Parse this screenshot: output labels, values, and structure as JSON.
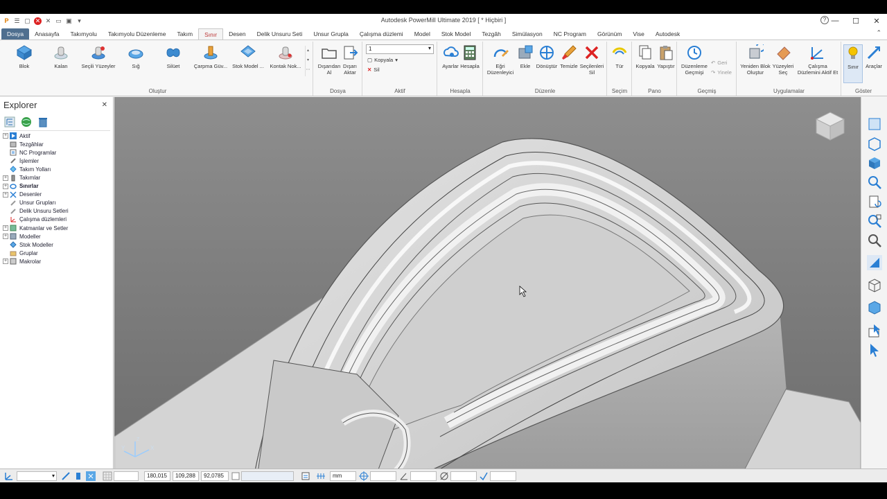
{
  "app": {
    "title": "Autodesk PowerMill Ultimate 2019   [ * Hiçbiri ]"
  },
  "window_controls": {
    "minimize": "—",
    "maximize": "☐",
    "close": "✕",
    "help": "?"
  },
  "tabs": [
    {
      "label": "Dosya"
    },
    {
      "label": "Anasayfa"
    },
    {
      "label": "Takımyolu"
    },
    {
      "label": "Takımyolu Düzenleme"
    },
    {
      "label": "Takım"
    },
    {
      "label": "Sınır"
    },
    {
      "label": "Desen"
    },
    {
      "label": "Delik Unsuru Seti"
    },
    {
      "label": "Unsur Grupla"
    },
    {
      "label": "Çalışma düzlemi"
    },
    {
      "label": "Model"
    },
    {
      "label": "Stok Model"
    },
    {
      "label": "Tezgâh"
    },
    {
      "label": "Simülasyon"
    },
    {
      "label": "NC Program"
    },
    {
      "label": "Görünüm"
    },
    {
      "label": "Vise"
    },
    {
      "label": "Autodesk"
    }
  ],
  "ribbon": {
    "olustur": {
      "label": "Oluştur",
      "buttons": [
        "Blok",
        "Kalan",
        "Seçili Yüzeyler",
        "Sığ",
        "Silüet",
        "Çarpma Güv...",
        "Stok Model ...",
        "Kontak Nok..."
      ]
    },
    "dosya": {
      "label": "Dosya",
      "buttons": [
        "Dışarıdan Al",
        "Dışarı Aktar"
      ]
    },
    "aktif": {
      "label": "Aktif",
      "combo_value": "1",
      "kopyala": "Kopyala",
      "sil": "Sil"
    },
    "hesapla": {
      "label": "Hesapla",
      "buttons": [
        "Ayarlar",
        "Hesapla"
      ]
    },
    "duzenle": {
      "label": "Düzenle",
      "buttons": [
        "Eğri Düzenleyici",
        "Ekle",
        "Dönüştür",
        "Temizle",
        "Seçilenleri Sil"
      ]
    },
    "secim": {
      "label": "Seçim",
      "buttons": [
        "Tür"
      ]
    },
    "pano": {
      "label": "Pano",
      "buttons": [
        "Kopyala",
        "Yapıştır"
      ]
    },
    "gecmis": {
      "label": "Geçmiş",
      "buttons": [
        "Düzenleme Geçmişi"
      ],
      "geri": "Geri",
      "yinele": "Yinele"
    },
    "uygulamalar": {
      "label": "Uygulamalar",
      "buttons": [
        "Yeniden Blok Oluştur",
        "Yüzeyleri Seç",
        "Çalışma Düzlemini Aktif Et"
      ]
    },
    "goster": {
      "label": "Göster",
      "buttons": [
        "Sınır",
        "Araçlar"
      ]
    }
  },
  "explorer": {
    "title": "Explorer",
    "items": [
      {
        "label": "Aktif",
        "expandable": true,
        "bold": false
      },
      {
        "label": "Tezgâhlar",
        "expandable": false,
        "bold": false
      },
      {
        "label": "NC Programlar",
        "expandable": false,
        "bold": false
      },
      {
        "label": "İşlemler",
        "expandable": false,
        "bold": false
      },
      {
        "label": "Takım Yolları",
        "expandable": false,
        "bold": false
      },
      {
        "label": "Takımlar",
        "expandable": true,
        "bold": false
      },
      {
        "label": "Sınırlar",
        "expandable": true,
        "bold": true
      },
      {
        "label": "Desenler",
        "expandable": true,
        "bold": false
      },
      {
        "label": "Unsur Grupları",
        "expandable": false,
        "bold": false
      },
      {
        "label": "Delik Unsuru Setleri",
        "expandable": false,
        "bold": false
      },
      {
        "label": "Çalışma düzlemleri",
        "expandable": false,
        "bold": false
      },
      {
        "label": "Katmanlar ve Setler",
        "expandable": true,
        "bold": false
      },
      {
        "label": "Modeller",
        "expandable": true,
        "bold": false
      },
      {
        "label": "Stok Modeller",
        "expandable": false,
        "bold": false
      },
      {
        "label": "Gruplar",
        "expandable": false,
        "bold": false
      },
      {
        "label": "Makrolar",
        "expandable": true,
        "bold": false
      }
    ]
  },
  "status": {
    "x": "180,015",
    "y": "109,288",
    "z": "92,0785",
    "units": "mm"
  },
  "colors": {
    "accent": "#2a7fd4",
    "file_tab": "#4f6f8f"
  }
}
